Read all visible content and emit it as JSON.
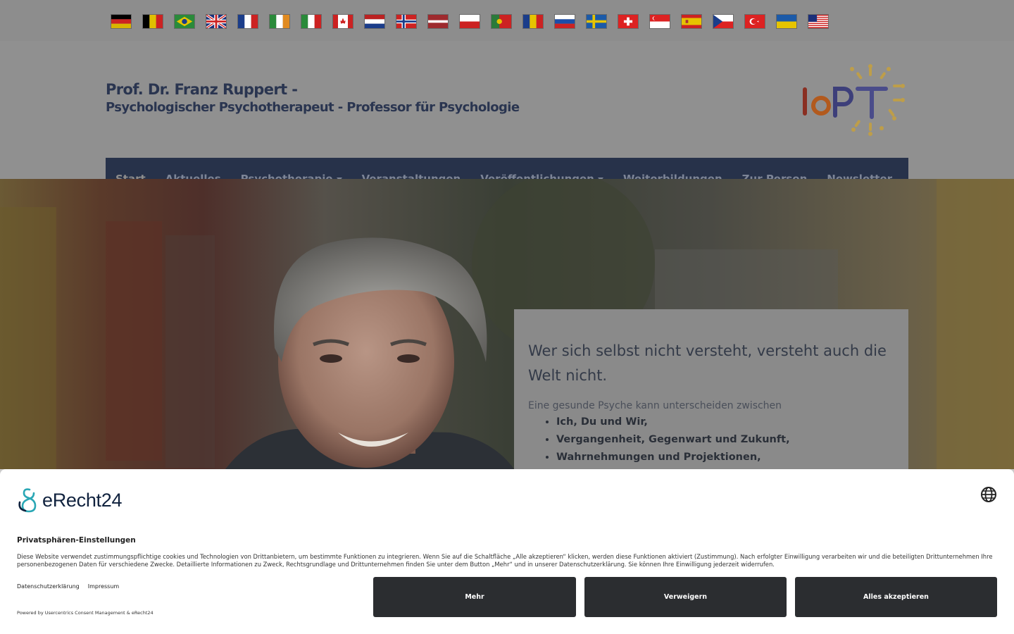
{
  "flags": [
    {
      "name": "flag-germany"
    },
    {
      "name": "flag-belgium"
    },
    {
      "name": "flag-brazil"
    },
    {
      "name": "flag-uk"
    },
    {
      "name": "flag-france"
    },
    {
      "name": "flag-ireland"
    },
    {
      "name": "flag-italy"
    },
    {
      "name": "flag-canada"
    },
    {
      "name": "flag-netherlands"
    },
    {
      "name": "flag-norway"
    },
    {
      "name": "flag-latvia"
    },
    {
      "name": "flag-poland"
    },
    {
      "name": "flag-portugal"
    },
    {
      "name": "flag-romania"
    },
    {
      "name": "flag-russia"
    },
    {
      "name": "flag-sweden"
    },
    {
      "name": "flag-switzerland"
    },
    {
      "name": "flag-singapore"
    },
    {
      "name": "flag-spain"
    },
    {
      "name": "flag-czech"
    },
    {
      "name": "flag-turkey"
    },
    {
      "name": "flag-ukraine"
    },
    {
      "name": "flag-usa"
    }
  ],
  "header": {
    "name": "Prof. Dr. Franz Ruppert -",
    "subtitle": "Psychologischer Psychotherapeut - Professor für Psychologie",
    "logo_text": "IoPT"
  },
  "nav": {
    "items": [
      {
        "label": "Start",
        "active": true,
        "dropdown": false
      },
      {
        "label": "Aktuelles",
        "active": false,
        "dropdown": false
      },
      {
        "label": "Psychotherapie",
        "active": false,
        "dropdown": true
      },
      {
        "label": "Veranstaltungen",
        "active": false,
        "dropdown": false
      },
      {
        "label": "Veröffentlichungen",
        "active": false,
        "dropdown": true
      },
      {
        "label": "Weiterbildungen",
        "active": false,
        "dropdown": false
      },
      {
        "label": "Zur Person",
        "active": false,
        "dropdown": false
      },
      {
        "label": "Newsletter",
        "active": false,
        "dropdown": false
      }
    ]
  },
  "hero": {
    "quote_title": "Wer sich selbst nicht versteht, versteht auch die Welt nicht.",
    "lead": "Eine gesunde Psyche kann unterscheiden zwischen",
    "list": [
      "Ich, Du und Wir,",
      "Vergangenheit, Gegenwart und Zukunft,",
      "Wahrnehmungen und Projektionen,"
    ]
  },
  "consent": {
    "brand": "eRecht24",
    "title": "Privatsphären-Einstellungen",
    "text": "Diese Website verwendet zustimmungspflichtige cookies und Technologien von Drittanbietern, um bestimmte Funktionen zu integrieren. Wenn Sie auf die Schaltfläche „Alle akzeptieren“ klicken, werden diese Funktionen aktiviert (Zustimmung). Nach erfolgter Einwilligung verarbeiten wir und die beteiligten Drittunternehmen Ihre personenbezogenen Daten für verschiedene Zwecke. Detaillierte Informationen zu Zweck, Rechtsgrundlage und Drittunternehmen finden Sie unter dem Button „Mehr“ und in unserer Datenschutzerklärung. Sie können Ihre Einwilligung jederzeit widerrufen.",
    "link_privacy": "Datenschutzerklärung",
    "link_imprint": "Impressum",
    "powered": "Powered by Usercentrics Consent Management & eRecht24",
    "btn_more": "Mehr",
    "btn_deny": "Verweigern",
    "btn_accept": "Alles akzeptieren"
  },
  "colors": {
    "nav_bg": "#27324a",
    "button_bg": "#2b2d30",
    "title_color": "#2a3550"
  }
}
